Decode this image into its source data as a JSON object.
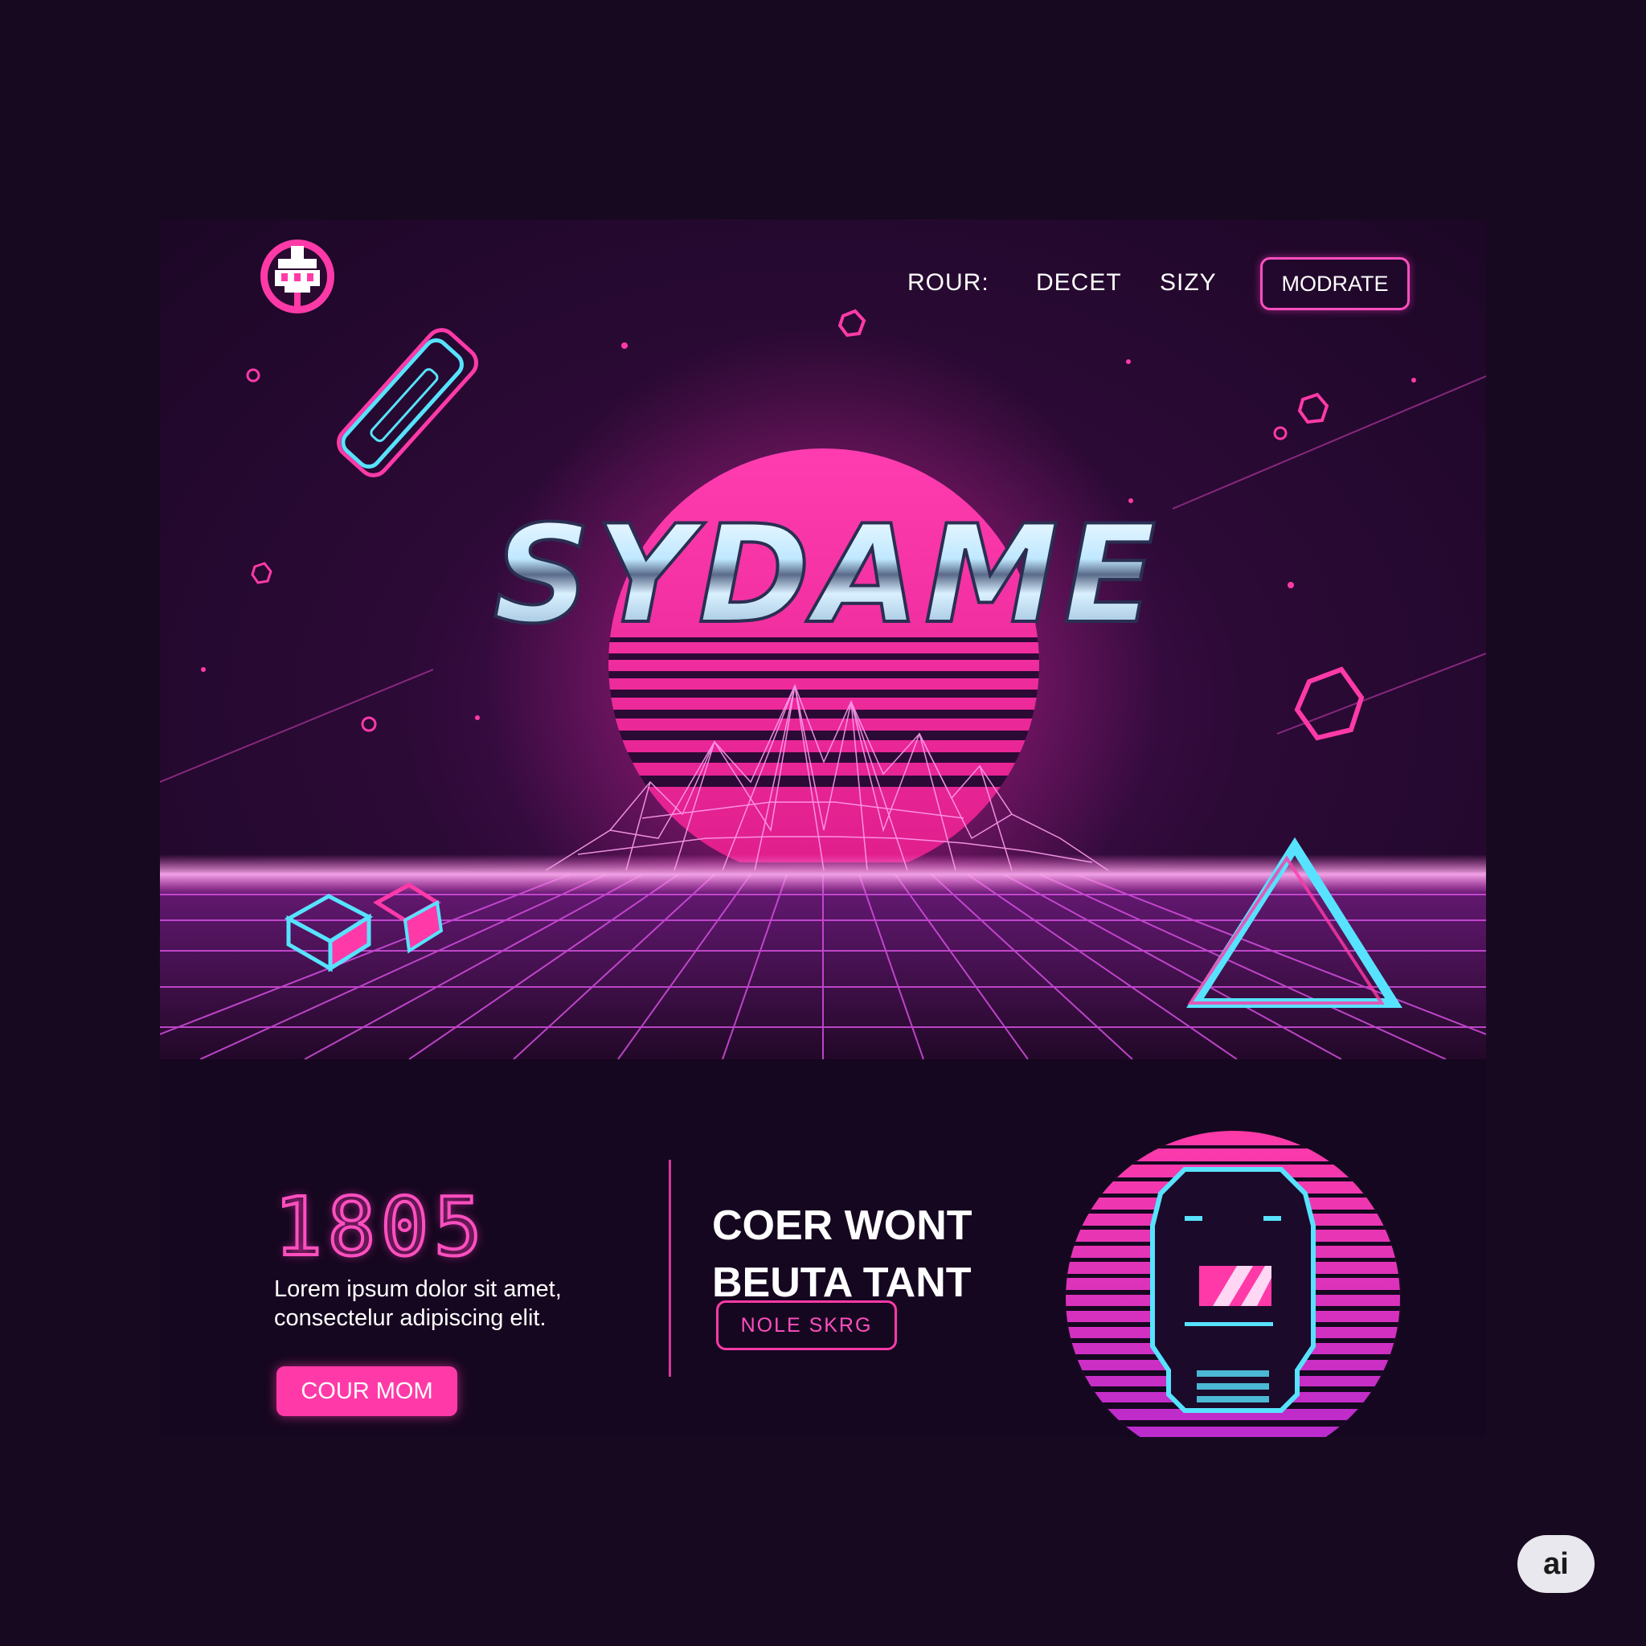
{
  "nav": {
    "links": [
      "ROUR:",
      "DECET",
      "SIZY"
    ],
    "button_label": "MODRATE"
  },
  "hero": {
    "title": "SYDAME"
  },
  "feature": {
    "number": "1805",
    "description": "Lorem ipsum dolor sit amet, consectelur adipiscing elit.",
    "cta_label": "COUR MOM"
  },
  "promo": {
    "headline_line1": "COER WONT",
    "headline_line2": "BEUTA TANT",
    "button_label": "NOLE SKRG"
  },
  "watermark": {
    "label": "ai"
  },
  "colors": {
    "background": "#17091f",
    "accent_pink": "#ff3aa8",
    "accent_cyan": "#57e3ff",
    "sun_pink": "#ff2ea6"
  }
}
